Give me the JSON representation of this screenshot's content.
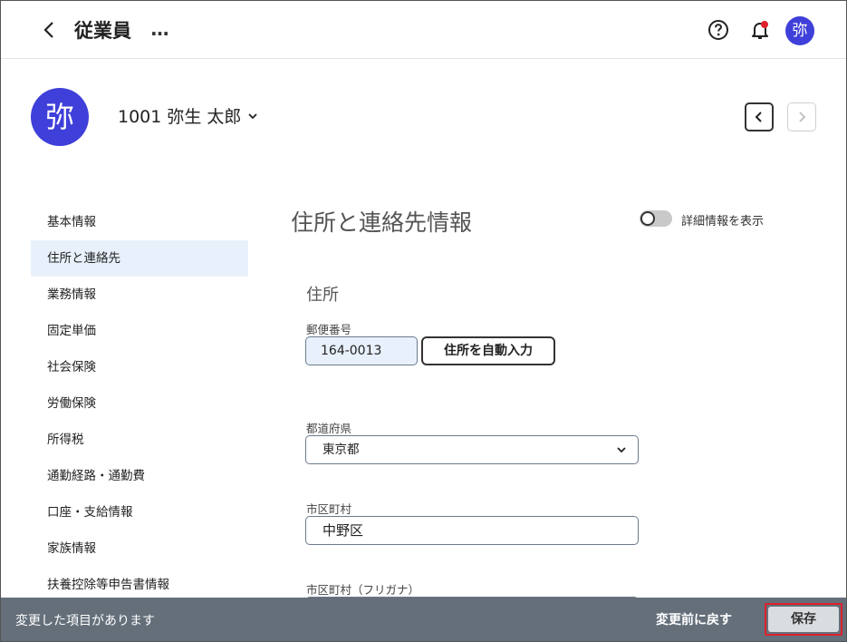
{
  "header": {
    "title": "従業員",
    "more": "…",
    "user_avatar": "弥",
    "notification_dot_color": "#e0202c"
  },
  "employee": {
    "avatar": "弥",
    "name": "1001 弥生 太郎",
    "avatar_color": "#3f3fd9"
  },
  "sidebar": {
    "items": [
      {
        "label": "基本情報",
        "active": false
      },
      {
        "label": "住所と連絡先",
        "active": true
      },
      {
        "label": "業務情報",
        "active": false
      },
      {
        "label": "固定単価",
        "active": false
      },
      {
        "label": "社会保険",
        "active": false
      },
      {
        "label": "労働保険",
        "active": false
      },
      {
        "label": "所得税",
        "active": false
      },
      {
        "label": "通勤経路・通勤費",
        "active": false
      },
      {
        "label": "口座・支給情報",
        "active": false
      },
      {
        "label": "家族情報",
        "active": false
      },
      {
        "label": "扶養控除等申告書情報",
        "active": false
      }
    ]
  },
  "main": {
    "section_title": "住所と連絡先情報",
    "toggle_label": "詳細情報を表示",
    "toggle_on": false,
    "subsection_title": "住所",
    "postal": {
      "label": "郵便番号",
      "value": "164-0013",
      "button": "住所を自動入力"
    },
    "prefecture": {
      "label": "都道府県",
      "value": "東京都"
    },
    "city": {
      "label": "市区町村",
      "value": "中野区"
    },
    "city_kana": {
      "label": "市区町村（フリガナ）"
    }
  },
  "footer": {
    "message": "変更した項目があります",
    "revert": "変更前に戻す",
    "save": "保存"
  }
}
